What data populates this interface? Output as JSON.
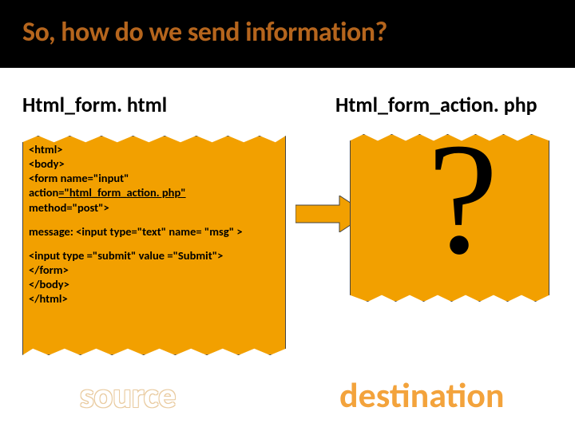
{
  "title": "So, how do we send information?",
  "left_file": "Html_form. html",
  "right_file": "Html_form_action. php",
  "code": {
    "l1": "<html>",
    "l2": "<body>",
    "l3": "<form name=\"input\"",
    "l4a": "action",
    "l4b": "=\"html_form_action. php\"",
    "l5": "method=\"post\">",
    "l6": "message: <input type=\"text\" name= \"msg\" >",
    "l7": "<input type =\"submit\" value =\"Submit\">",
    "l8": "</form>",
    "l9": "</body>",
    "l10": "</html>"
  },
  "qmark": "?",
  "source": "source",
  "destination": "destination"
}
